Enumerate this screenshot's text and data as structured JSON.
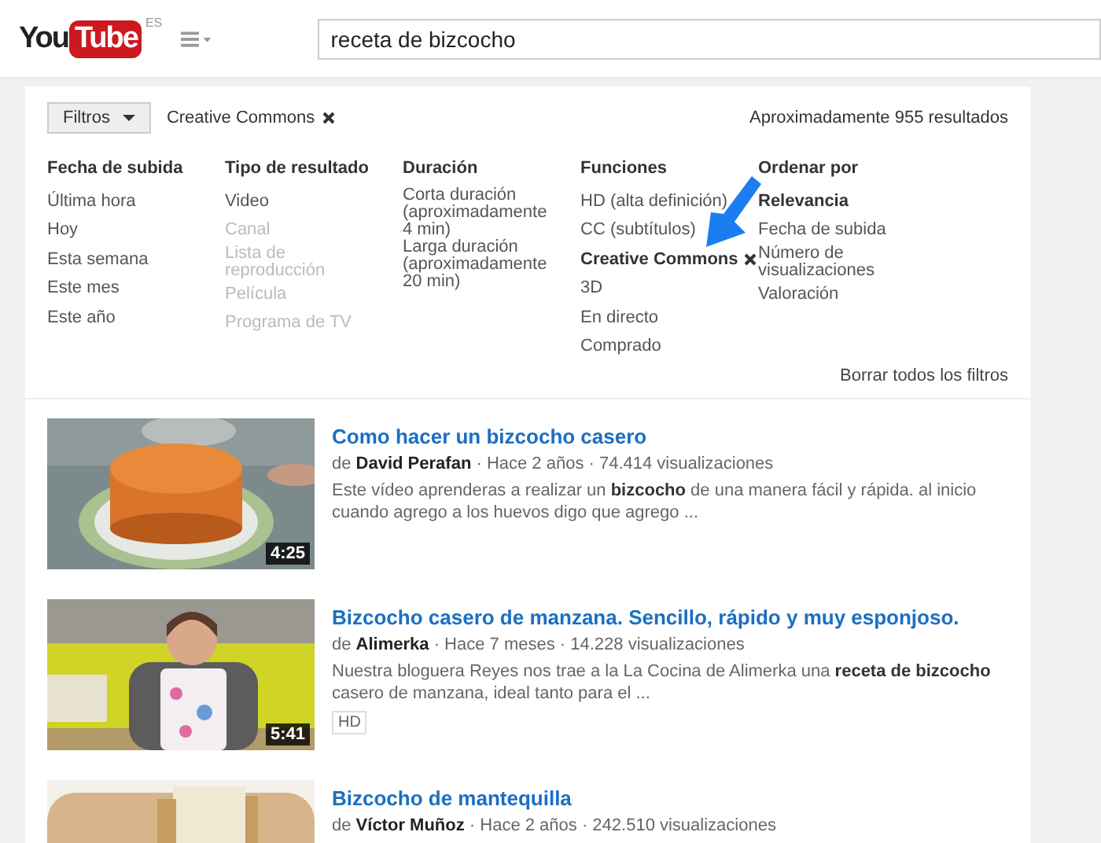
{
  "header": {
    "logo_you": "You",
    "logo_tube": "Tube",
    "logo_region": "ES",
    "search": {
      "value": "receta de bizcocho"
    }
  },
  "filter_bar": {
    "button": "Filtros",
    "active_filter": "Creative Commons",
    "result_count": "Aproximadamente 955 resultados"
  },
  "filter_columns": [
    {
      "heading": "Fecha de subida",
      "items": [
        {
          "label": "Última hora",
          "selected": false,
          "disabled": false,
          "removable": false
        },
        {
          "label": "Hoy",
          "selected": false,
          "disabled": false,
          "removable": false
        },
        {
          "label": "Esta semana",
          "selected": false,
          "disabled": false,
          "removable": false
        },
        {
          "label": "Este mes",
          "selected": false,
          "disabled": false,
          "removable": false
        },
        {
          "label": "Este año",
          "selected": false,
          "disabled": false,
          "removable": false
        }
      ]
    },
    {
      "heading": "Tipo de resultado",
      "items": [
        {
          "label": "Video",
          "selected": false,
          "disabled": false,
          "removable": false
        },
        {
          "label": "Canal",
          "selected": false,
          "disabled": true,
          "removable": false
        },
        {
          "label": "Lista de reproducción",
          "selected": false,
          "disabled": true,
          "removable": false
        },
        {
          "label": "Película",
          "selected": false,
          "disabled": true,
          "removable": false
        },
        {
          "label": "Programa de TV",
          "selected": false,
          "disabled": true,
          "removable": false
        }
      ]
    },
    {
      "heading": "Duración",
      "items": [
        {
          "label": "Corta duración (aproximadamente 4 min)",
          "selected": false,
          "disabled": false,
          "removable": false
        },
        {
          "label": "Larga duración (aproximadamente 20 min)",
          "selected": false,
          "disabled": false,
          "removable": false
        }
      ]
    },
    {
      "heading": "Funciones",
      "items": [
        {
          "label": "HD (alta definición)",
          "selected": false,
          "disabled": false,
          "removable": false
        },
        {
          "label": "CC (subtítulos)",
          "selected": false,
          "disabled": false,
          "removable": false
        },
        {
          "label": "Creative Commons",
          "selected": true,
          "disabled": false,
          "removable": true
        },
        {
          "label": "3D",
          "selected": false,
          "disabled": false,
          "removable": false
        },
        {
          "label": "En directo",
          "selected": false,
          "disabled": false,
          "removable": false
        },
        {
          "label": "Comprado",
          "selected": false,
          "disabled": false,
          "removable": false
        }
      ]
    },
    {
      "heading": "Ordenar por",
      "items": [
        {
          "label": "Relevancia",
          "selected": true,
          "disabled": false,
          "removable": false
        },
        {
          "label": "Fecha de subida",
          "selected": false,
          "disabled": false,
          "removable": false
        },
        {
          "label": "Número de visualizaciones",
          "selected": false,
          "disabled": false,
          "removable": false
        },
        {
          "label": "Valoración",
          "selected": false,
          "disabled": false,
          "removable": false
        }
      ]
    }
  ],
  "clear_filters": "Borrar todos los filtros",
  "results": [
    {
      "title": "Como hacer un bizcocho casero",
      "meta": "de **David Perafan** · Hace 2 años · 74.414 visualizaciones",
      "description": "Este vídeo aprenderas a realizar un **bizcocho** de una manera fácil y rápida. al inicio cuando agrego a los huevos digo que agrego ...",
      "duration": "4:25",
      "thumbnail": {
        "kind": "cake"
      }
    },
    {
      "title": "Bizcocho casero de manzana. Sencillo, rápido y muy esponjoso.",
      "meta": "de **Alimerka** · Hace 7 meses · 14.228 visualizaciones",
      "description": "Nuestra bloguera Reyes nos trae a la La Cocina de Alimerka una **receta de bizcocho** casero de manzana, ideal tanto para el ...",
      "duration": "5:41",
      "badge": "HD",
      "thumbnail": {
        "kind": "cook"
      }
    },
    {
      "title": "Bizcocho de mantequilla",
      "meta": "de **Víctor Muñoz** · Hace 2 años · 242.510 visualizaciones",
      "thumbnail": {
        "kind": "bread"
      }
    }
  ]
}
